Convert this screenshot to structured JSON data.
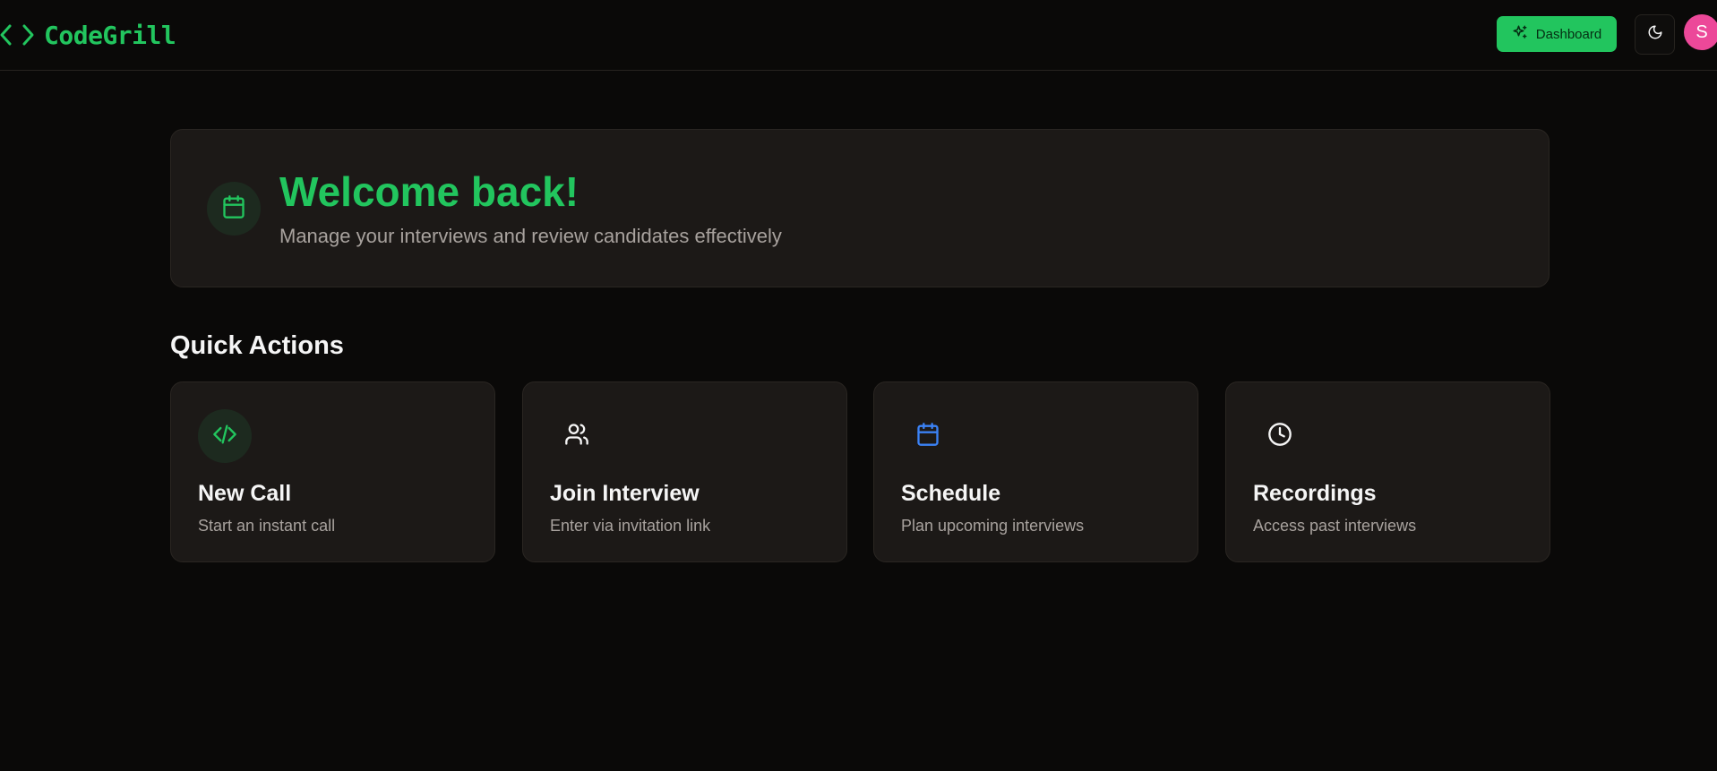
{
  "header": {
    "logo_text": "CodeGrill",
    "dashboard_label": "Dashboard",
    "avatar_initial": "S"
  },
  "welcome": {
    "title": "Welcome back!",
    "subtitle": "Manage your interviews and review candidates effectively",
    "icon": "calendar-icon"
  },
  "quick_actions": {
    "title": "Quick Actions",
    "cards": [
      {
        "title": "New Call",
        "description": "Start an instant call",
        "icon": "code-icon",
        "icon_color": "#22c55e"
      },
      {
        "title": "Join Interview",
        "description": "Enter via invitation link",
        "icon": "users-icon",
        "icon_color": "#f5f5f5"
      },
      {
        "title": "Schedule",
        "description": "Plan upcoming interviews",
        "icon": "calendar-icon",
        "icon_color": "#3b82f6"
      },
      {
        "title": "Recordings",
        "description": "Access past interviews",
        "icon": "clock-icon",
        "icon_color": "#f5f5f5"
      }
    ]
  },
  "colors": {
    "accent": "#22c55e",
    "background": "#0a0908",
    "card": "#1c1917",
    "avatar": "#ec4899",
    "muted_text": "#a8a29e"
  }
}
